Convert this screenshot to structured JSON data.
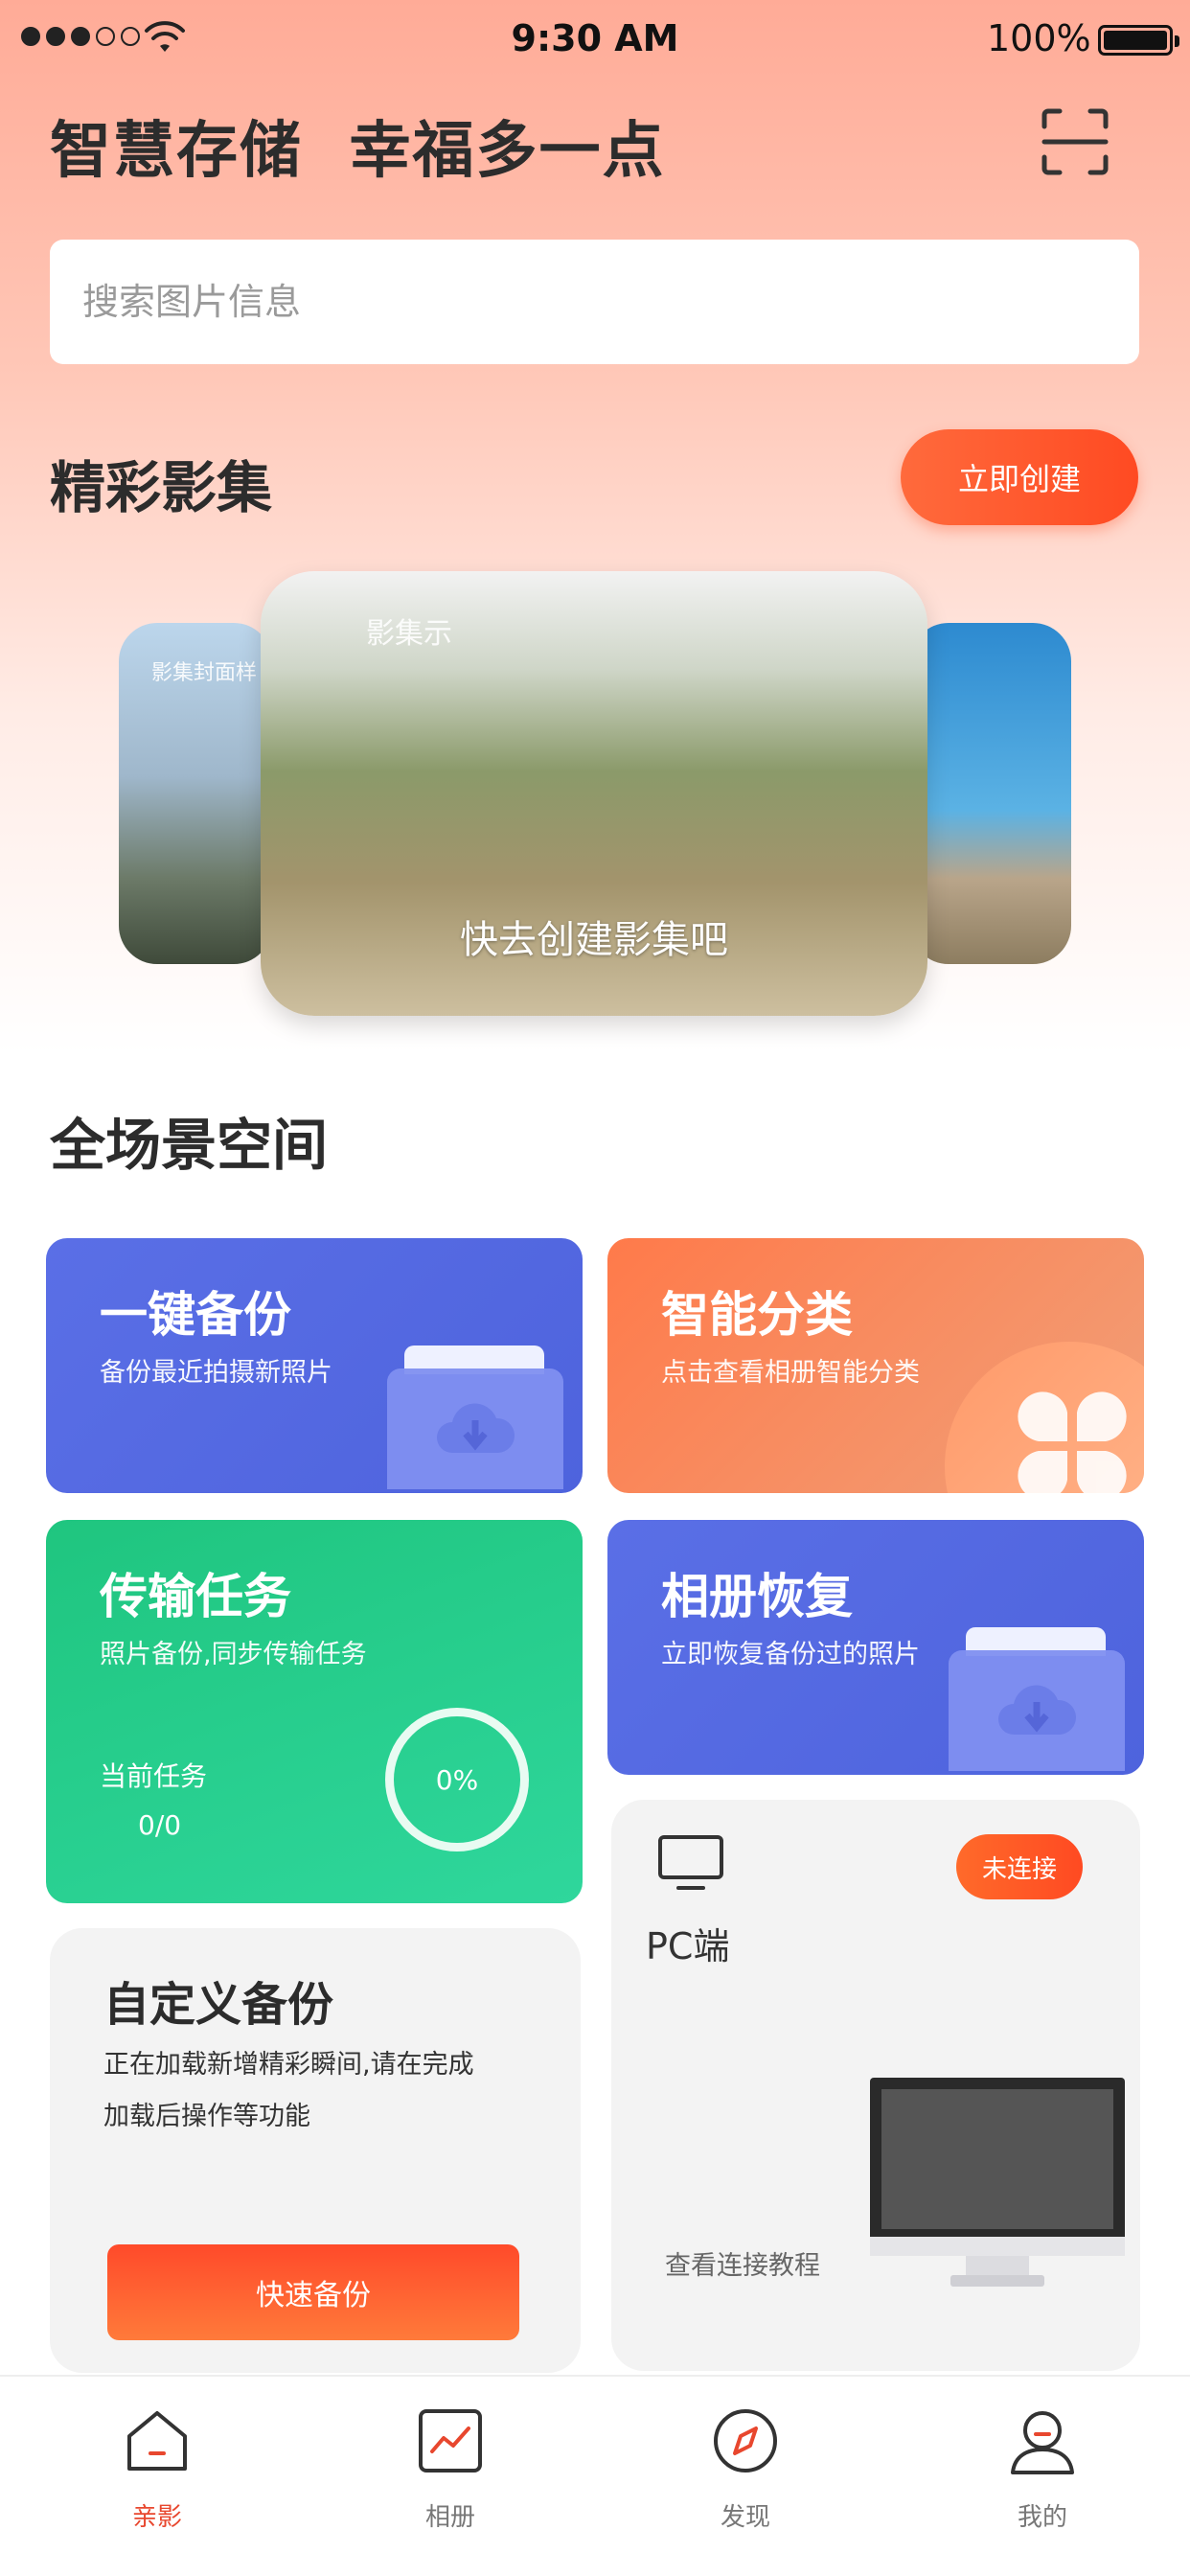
{
  "status_bar": {
    "time": "9:30 AM",
    "battery": "100%"
  },
  "header": {
    "title": "智慧存储  幸福多一点"
  },
  "search": {
    "placeholder": "搜索图片信息"
  },
  "albums": {
    "title": "精彩影集",
    "create_label": "立即创建",
    "side_caption": "影集封面样",
    "main_tag": "影集示",
    "main_caption": "快去创建影集吧"
  },
  "scenes": {
    "title": "全场景空间"
  },
  "cards": {
    "backup": {
      "title": "一键备份",
      "subtitle": "备份最近拍摄新照片"
    },
    "classify": {
      "title": "智能分类",
      "subtitle": "点击查看相册智能分类"
    },
    "transfer": {
      "title": "传输任务",
      "subtitle": "照片备份,同步传输任务",
      "task_label": "当前任务",
      "task_count": "0/0",
      "progress": "0%"
    },
    "restore": {
      "title": "相册恢复",
      "subtitle": "立即恢复备份过的照片"
    },
    "custom": {
      "title": "自定义备份",
      "desc_line1": "正在加载新增精彩瞬间,请在完成",
      "desc_line2": "加载后操作等功能",
      "button_label": "快速备份"
    },
    "pc": {
      "label": "PC端",
      "status": "未连接",
      "tutorial": "查看连接教程"
    }
  },
  "tabs": [
    {
      "label": "亲影",
      "icon": "home-icon",
      "active": true
    },
    {
      "label": "相册",
      "icon": "album-chart-icon",
      "active": false
    },
    {
      "label": "发现",
      "icon": "compass-icon",
      "active": false
    },
    {
      "label": "我的",
      "icon": "user-icon",
      "active": false
    }
  ],
  "colors": {
    "accent": "#ff5a2e",
    "blue_card": "#5566e0",
    "green_card": "#25cf8e",
    "orange_card": "#ff8a5a",
    "tab_active": "#e8472e"
  }
}
